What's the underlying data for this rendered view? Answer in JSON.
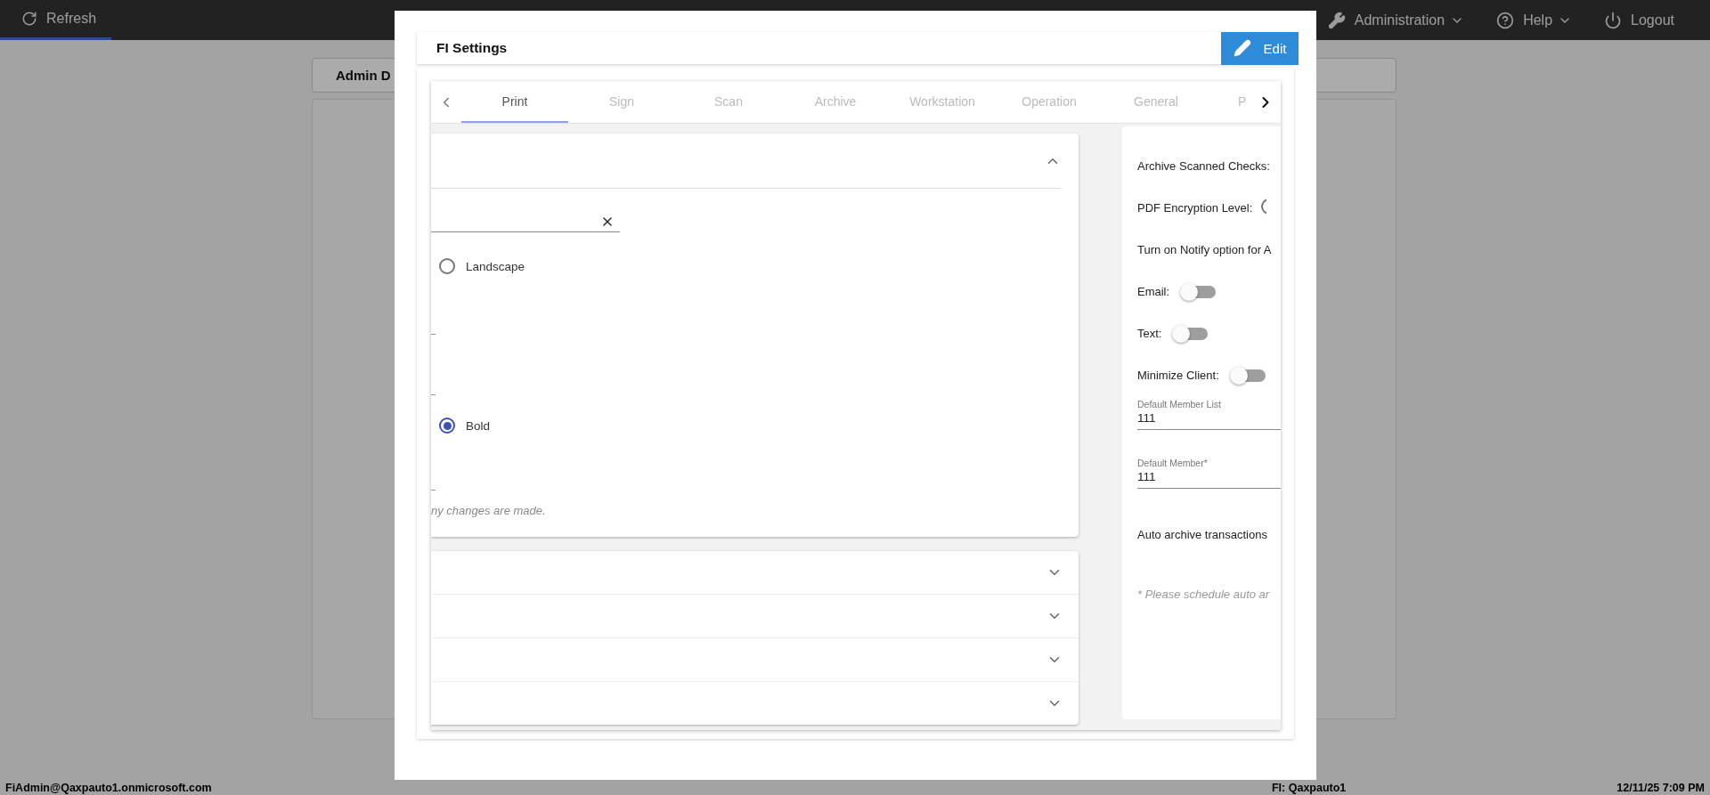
{
  "topbar": {
    "refresh": {
      "label": "Refresh",
      "selected": true
    },
    "menus": [
      {
        "kind": "wrench",
        "label": "Administration",
        "dropdown": true
      },
      {
        "kind": "help",
        "label": "Help",
        "dropdown": true
      },
      {
        "kind": "power",
        "label": "Logout",
        "dropdown": false
      }
    ]
  },
  "page": {
    "tab": "Admin D"
  },
  "modal": {
    "title": "FI Settings",
    "edit_button": "Edit",
    "tabs": [
      {
        "label": "Print",
        "selected": true
      },
      {
        "label": "Sign",
        "selected": false
      },
      {
        "label": "Scan",
        "selected": false
      },
      {
        "label": "Archive",
        "selected": false
      },
      {
        "label": "Workstation",
        "selected": false
      },
      {
        "label": "Operation",
        "selected": false
      },
      {
        "label": "General",
        "selected": false
      },
      {
        "label": "P",
        "selected": false
      }
    ],
    "left_panel": {
      "expanded": true,
      "radios": [
        {
          "label": "Landscape",
          "selected": false
        },
        {
          "label": "Bold",
          "selected": true
        }
      ],
      "note": "ny changes are made.",
      "sections": [
        {
          "expanded": false
        },
        {
          "expanded": false
        },
        {
          "expanded": false
        },
        {
          "expanded": false
        }
      ]
    },
    "right_panel": [
      {
        "kind": "label",
        "text": "Archive Scanned Checks:"
      },
      {
        "kind": "radio",
        "text": "PDF Encryption Level:",
        "selected": false
      },
      {
        "kind": "label",
        "text": "Turn on Notify option for A"
      },
      {
        "kind": "toggle",
        "text": "Email:",
        "on": false
      },
      {
        "kind": "toggle",
        "text": "Text:",
        "on": false
      },
      {
        "kind": "toggle",
        "text": "Minimize Client:",
        "on": false
      },
      {
        "kind": "field",
        "label": "Default Member List",
        "value": "111"
      },
      {
        "kind": "field",
        "label": "Default Member*",
        "value": "111"
      },
      {
        "kind": "label",
        "text": "Auto archive transactions"
      },
      {
        "kind": "note",
        "text": "* Please schedule auto ar"
      }
    ]
  },
  "status_bar": {
    "user": "FiAdmin@Qaxpauto1.onmicrosoft.com",
    "fi": "FI: Qaxpauto1",
    "datetime": "12/11/25 7:09 PM"
  }
}
